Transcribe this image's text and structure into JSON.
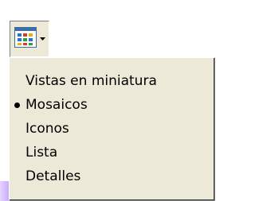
{
  "toolbar": {
    "view_button": {
      "icon": "tiles-view-icon",
      "arrow": "dropdown-arrow-icon",
      "pressed": true
    }
  },
  "menu": {
    "items": [
      {
        "label": "Vistas en miniatura",
        "selected": false
      },
      {
        "label": "Mosaicos",
        "selected": true
      },
      {
        "label": "Iconos",
        "selected": false
      },
      {
        "label": "Lista",
        "selected": false
      },
      {
        "label": "Detalles",
        "selected": false
      }
    ]
  },
  "colors": {
    "face": "#ece9d8",
    "shadow": "#808080",
    "highlight": "#ffffff",
    "text": "#000000",
    "icon_blue": "#3a6ea5"
  }
}
